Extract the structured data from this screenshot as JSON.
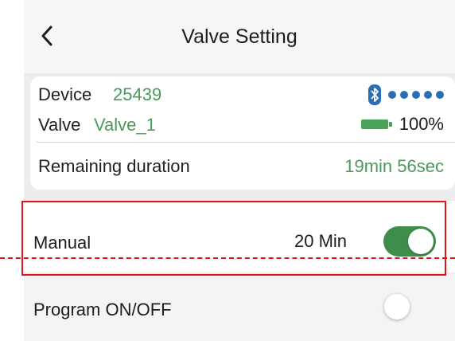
{
  "header": {
    "title": "Valve Setting"
  },
  "device": {
    "device_label": "Device",
    "device_id": "25439",
    "valve_label": "Valve",
    "valve_name": "Valve_1",
    "battery_percent": "100%",
    "remaining_label": "Remaining duration",
    "remaining_value": "19min 56sec",
    "signal_strength": 5
  },
  "manual": {
    "label": "Manual",
    "duration": "20 Min",
    "enabled": true
  },
  "program": {
    "label": "Program ON/OFF",
    "enabled": false
  },
  "colors": {
    "accent_green": "#3e8e49",
    "text_green": "#4a9a5c",
    "bluetooth_blue": "#2b6fb3",
    "highlight_red": "#e0121b"
  },
  "icons": {
    "back": "chevron-left-icon",
    "bluetooth": "bluetooth-icon",
    "battery": "battery-icon"
  }
}
